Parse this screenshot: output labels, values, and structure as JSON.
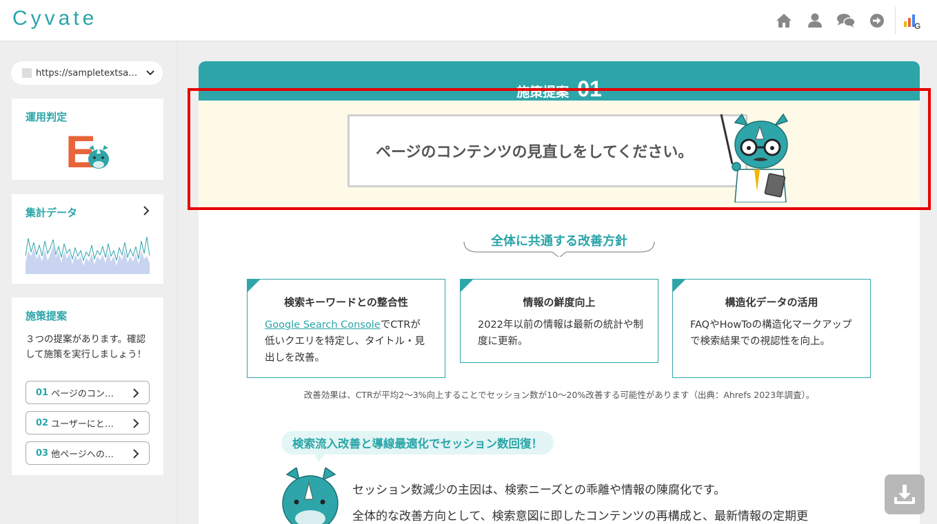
{
  "app": {
    "logo": "Cyvate"
  },
  "header": {
    "icons": [
      "home-icon",
      "user-icon",
      "chat-icon",
      "logout-icon",
      "google-analytics-icon"
    ]
  },
  "sidebar": {
    "url_selector": {
      "value": "https://sampletextsa…"
    },
    "judgement": {
      "title": "運用判定",
      "grade": "E"
    },
    "stats": {
      "title": "集計データ"
    },
    "proposals": {
      "title": "施策提案",
      "description": "３つの提案があります。確認して施策を実行しましょう！",
      "items": [
        {
          "num": "01",
          "label": "ページのコン…"
        },
        {
          "num": "02",
          "label": "ユーザーにと…"
        },
        {
          "num": "03",
          "label": "他ページへの…"
        }
      ]
    }
  },
  "main": {
    "header_label": "施策提案",
    "header_num": "01",
    "hero_text": "ページのコンテンツの見直しをしてください。",
    "policy_title": "全体に共通する改善方針",
    "cards": [
      {
        "title": "検索キーワードとの整合性",
        "link": "Google Search Console",
        "body": "でCTRが低いクエリを特定し、タイトル・見出しを改善。"
      },
      {
        "title": "情報の鮮度向上",
        "body": "2022年以前の情報は最新の統計や制度に更新。"
      },
      {
        "title": "構造化データの活用",
        "body": "FAQやHowToの構造化マークアップで検索結果での視認性を向上。"
      }
    ],
    "note": "改善効果は、CTRが平均2〜3%向上することでセッション数が10〜20%改善する可能性があります（出典：Ahrefs 2023年調査）。",
    "bubble": "検索流入改善と導線最適化でセッション数回復！",
    "paragraphs": [
      "セッション数減少の主因は、検索ニーズとの乖離や情報の陳腐化です。",
      "全体的な改善方向として、検索意図に即したコンテンツの再構成と、最新情報の定期更"
    ]
  },
  "colors": {
    "accent": "#2ea5a9",
    "grade": "#e8643a",
    "highlight": "#e60000",
    "hero_bg": "#fff9e8"
  }
}
